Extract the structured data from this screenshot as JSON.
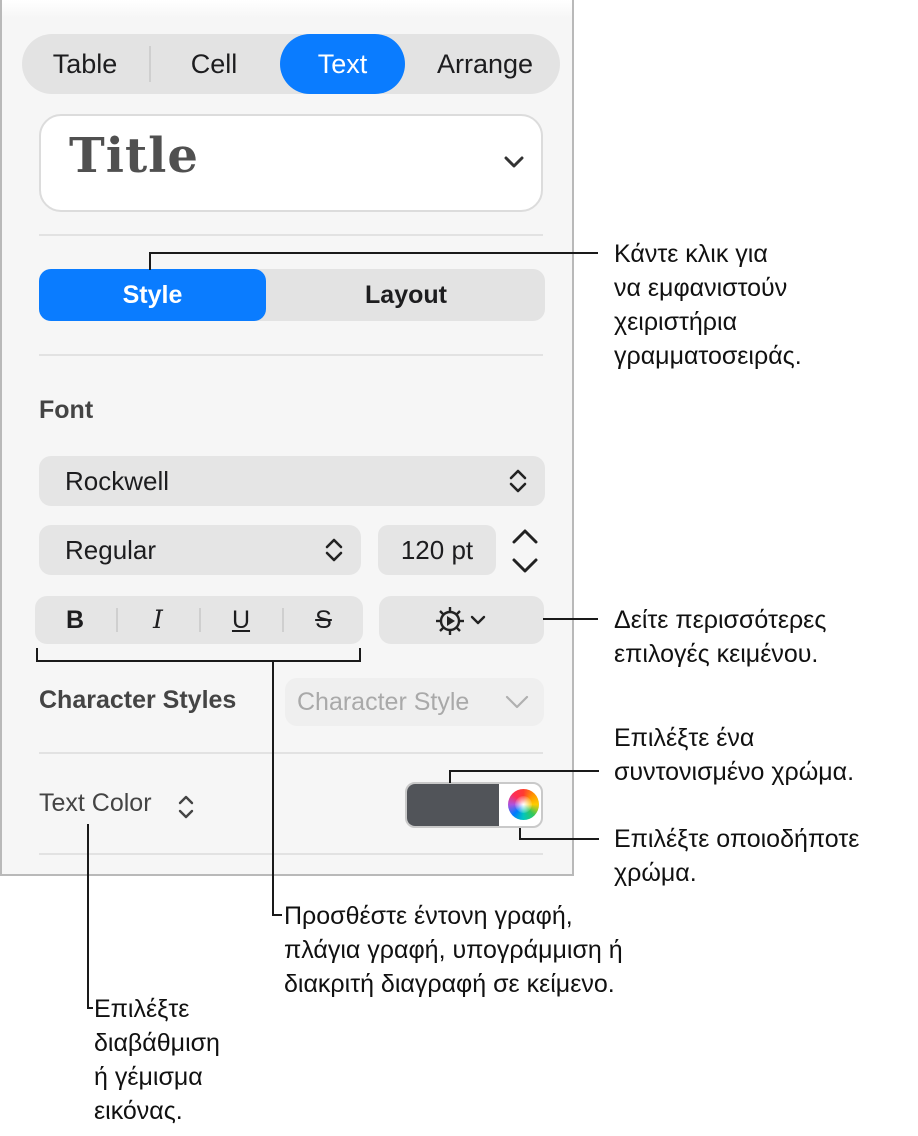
{
  "tabs": [
    {
      "label": "Table",
      "active": false
    },
    {
      "label": "Cell",
      "active": false
    },
    {
      "label": "Text",
      "active": true
    },
    {
      "label": "Arrange",
      "active": false
    }
  ],
  "paragraph_style": {
    "value": "Title"
  },
  "segments": {
    "style": "Style",
    "layout": "Layout",
    "active": "Style"
  },
  "font": {
    "section_label": "Font",
    "family": "Rockwell",
    "typeface": "Regular",
    "size": "120 pt"
  },
  "format_buttons": {
    "bold": "B",
    "italic": "I",
    "underline": "U",
    "strike": "S"
  },
  "character_styles": {
    "label": "Character Styles",
    "placeholder": "Character Style"
  },
  "text_color": {
    "label": "Text Color",
    "swatch_color": "#515459"
  },
  "accent_color": "#0a7cff",
  "callouts": {
    "style_tab": [
      "Κάντε κλικ για",
      "να εμφανιστούν",
      "χειριστήρια",
      "γραμματοσειράς."
    ],
    "more_options": [
      "Δείτε περισσότερες",
      "επιλογές κειμένου."
    ],
    "preset_color": [
      "Επιλέξτε ένα",
      "συντονισμένο χρώμα."
    ],
    "any_color": [
      "Επιλέξτε οποιοδήποτε",
      "χρώμα."
    ],
    "format": [
      "Προσθέστε έντονη γραφή,",
      "πλάγια γραφή, υπογράμμιση ή",
      "διακριτή διαγραφή σε κείμενο."
    ],
    "fill": [
      "Επιλέξτε",
      "διαβάθμιση",
      "ή γέμισμα",
      "εικόνας."
    ]
  }
}
